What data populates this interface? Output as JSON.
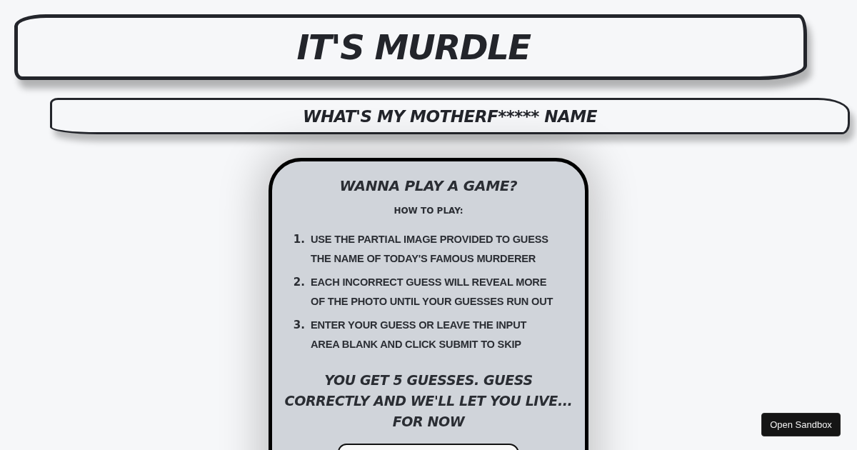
{
  "header": {
    "title": "IT'S MURDLE",
    "subtitle": "WHAT'S MY MOTHERF***** NAME"
  },
  "card": {
    "heading": "WANNA PLAY A GAME?",
    "subheading": "HOW TO PLAY:",
    "steps": [
      {
        "number": "1.",
        "text": "USE THE PARTIAL IMAGE PROVIDED TO GUESS THE NAME OF TODAY'S FAMOUS MURDERER"
      },
      {
        "number": "2.",
        "text": "EACH INCORRECT GUESS WILL REVEAL MORE OF THE PHOTO UNTIL YOUR GUESSES RUN OUT"
      },
      {
        "number": "3.",
        "text": "ENTER YOUR GUESS OR LEAVE THE INPUT AREA BLANK AND CLICK SUBMIT TO SKIP"
      }
    ],
    "warning": "YOU GET 5 GUESSES. GUESS CORRECTLY AND WE'LL LET YOU LIVE... FOR NOW"
  },
  "sandbox_button": {
    "label": "Open Sandbox"
  }
}
